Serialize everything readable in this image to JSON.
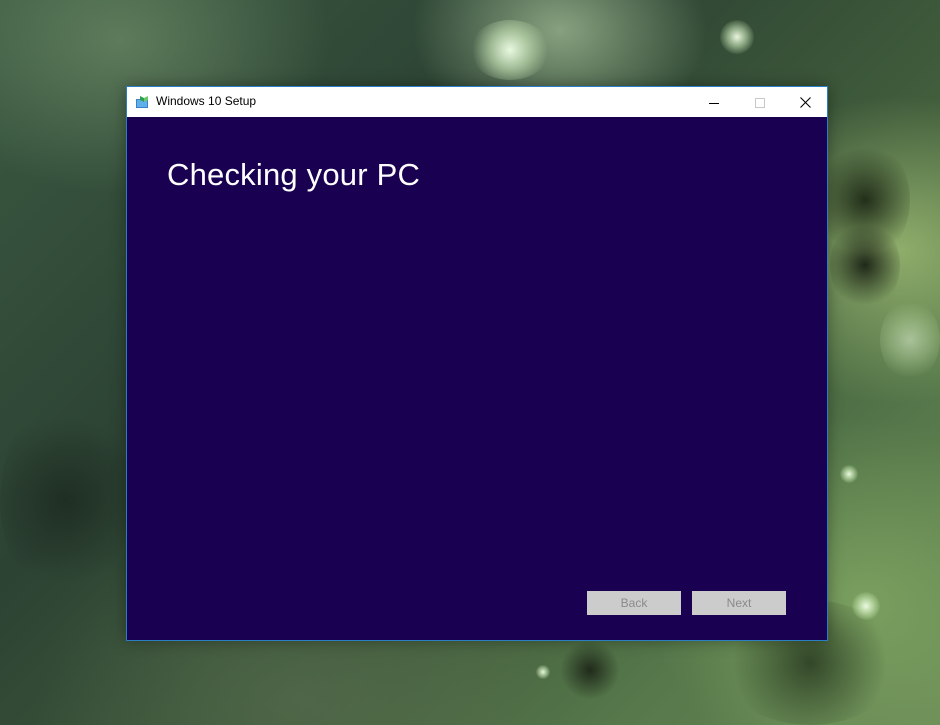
{
  "desktop": {
    "wallpaper_colors": [
      "#2c4233",
      "#3f5b3b",
      "#6b8c57"
    ]
  },
  "window": {
    "title": "Windows 10 Setup",
    "app_icon": "windows-setup-icon",
    "controls": {
      "minimize": "minimize-icon",
      "maximize": "maximize-icon",
      "close": "close-icon"
    },
    "background_color": "#1a0050",
    "border_color": "#2a7fc4"
  },
  "content": {
    "heading": "Checking your PC"
  },
  "buttons": {
    "back_label": "Back",
    "next_label": "Next",
    "back_enabled": false,
    "next_enabled": false
  }
}
